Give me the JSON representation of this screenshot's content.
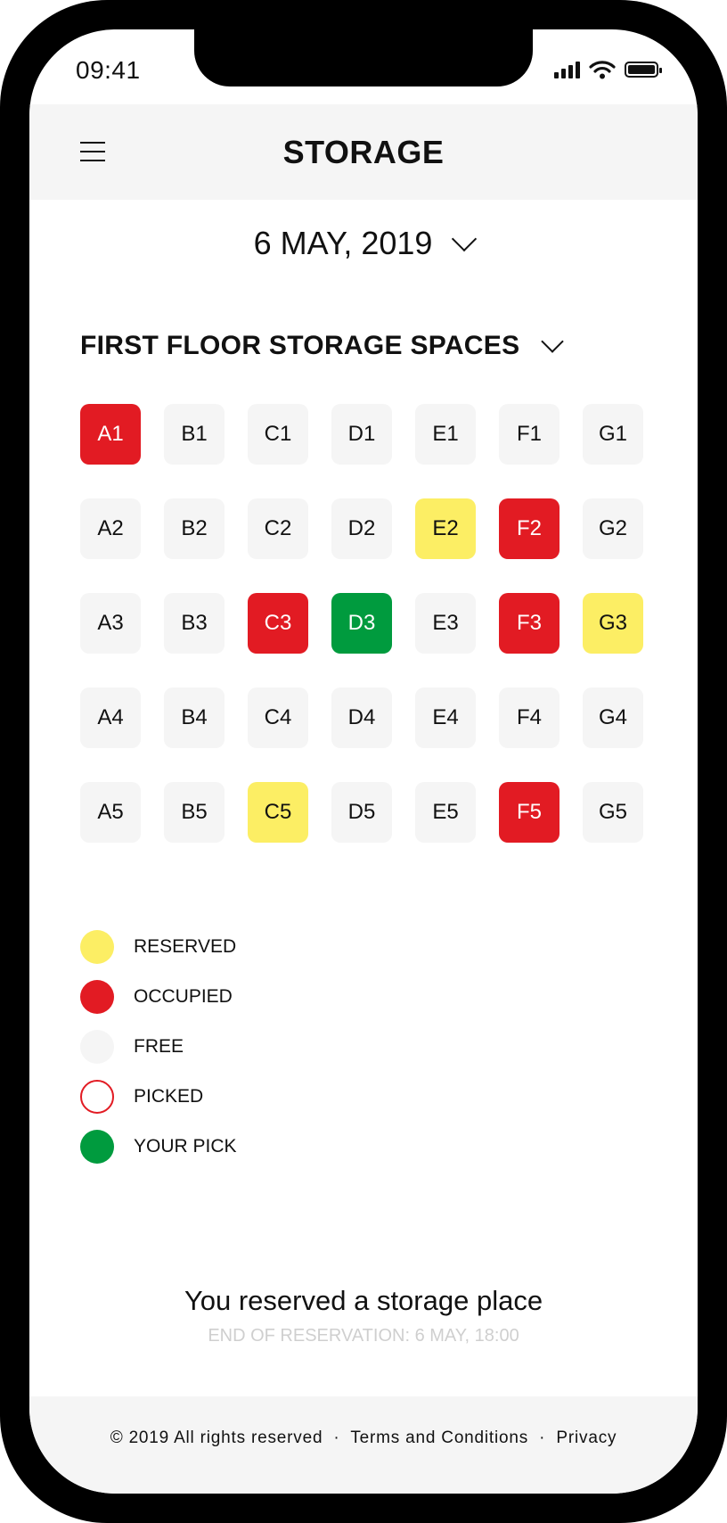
{
  "status_bar": {
    "time": "09:41"
  },
  "header": {
    "title": "STORAGE"
  },
  "date": {
    "value": "6 MAY, 2019"
  },
  "floor": {
    "label": "FIRST FLOOR STORAGE SPACES"
  },
  "grid": {
    "cells": [
      {
        "id": "A1",
        "state": "occupied"
      },
      {
        "id": "B1",
        "state": "free"
      },
      {
        "id": "C1",
        "state": "free"
      },
      {
        "id": "D1",
        "state": "free"
      },
      {
        "id": "E1",
        "state": "free"
      },
      {
        "id": "F1",
        "state": "free"
      },
      {
        "id": "G1",
        "state": "free"
      },
      {
        "id": "A2",
        "state": "free"
      },
      {
        "id": "B2",
        "state": "free"
      },
      {
        "id": "C2",
        "state": "free"
      },
      {
        "id": "D2",
        "state": "free"
      },
      {
        "id": "E2",
        "state": "reserved"
      },
      {
        "id": "F2",
        "state": "occupied"
      },
      {
        "id": "G2",
        "state": "free"
      },
      {
        "id": "A3",
        "state": "free"
      },
      {
        "id": "B3",
        "state": "free"
      },
      {
        "id": "C3",
        "state": "occupied"
      },
      {
        "id": "D3",
        "state": "yourpick"
      },
      {
        "id": "E3",
        "state": "free"
      },
      {
        "id": "F3",
        "state": "occupied"
      },
      {
        "id": "G3",
        "state": "reserved"
      },
      {
        "id": "A4",
        "state": "free"
      },
      {
        "id": "B4",
        "state": "free"
      },
      {
        "id": "C4",
        "state": "free"
      },
      {
        "id": "D4",
        "state": "free"
      },
      {
        "id": "E4",
        "state": "free"
      },
      {
        "id": "F4",
        "state": "free"
      },
      {
        "id": "G4",
        "state": "free"
      },
      {
        "id": "A5",
        "state": "free"
      },
      {
        "id": "B5",
        "state": "free"
      },
      {
        "id": "C5",
        "state": "reserved"
      },
      {
        "id": "D5",
        "state": "free"
      },
      {
        "id": "E5",
        "state": "free"
      },
      {
        "id": "F5",
        "state": "occupied"
      },
      {
        "id": "G5",
        "state": "free"
      }
    ]
  },
  "legend": {
    "items": [
      {
        "label": "RESERVED",
        "fill": "#fcee64",
        "border": "none"
      },
      {
        "label": "OCCUPIED",
        "fill": "#e21b23",
        "border": "none"
      },
      {
        "label": "FREE",
        "fill": "#f5f5f5",
        "border": "none"
      },
      {
        "label": "PICKED",
        "fill": "#ffffff",
        "border": "#e21b23"
      },
      {
        "label": "YOUR PICK",
        "fill": "#009b3e",
        "border": "none"
      }
    ]
  },
  "message": {
    "title": "You reserved a storage place",
    "subtitle": "END OF RESERVATION: 6 MAY, 18:00"
  },
  "footer": {
    "copyright": "© 2019 All rights reserved",
    "terms": "Terms and Conditions",
    "privacy": "Privacy",
    "separator": "·"
  },
  "colors": {
    "reserved": "#fcee64",
    "occupied": "#e21b23",
    "free": "#f5f5f5",
    "your_pick": "#009b3e",
    "header_bg": "#f5f5f5"
  }
}
